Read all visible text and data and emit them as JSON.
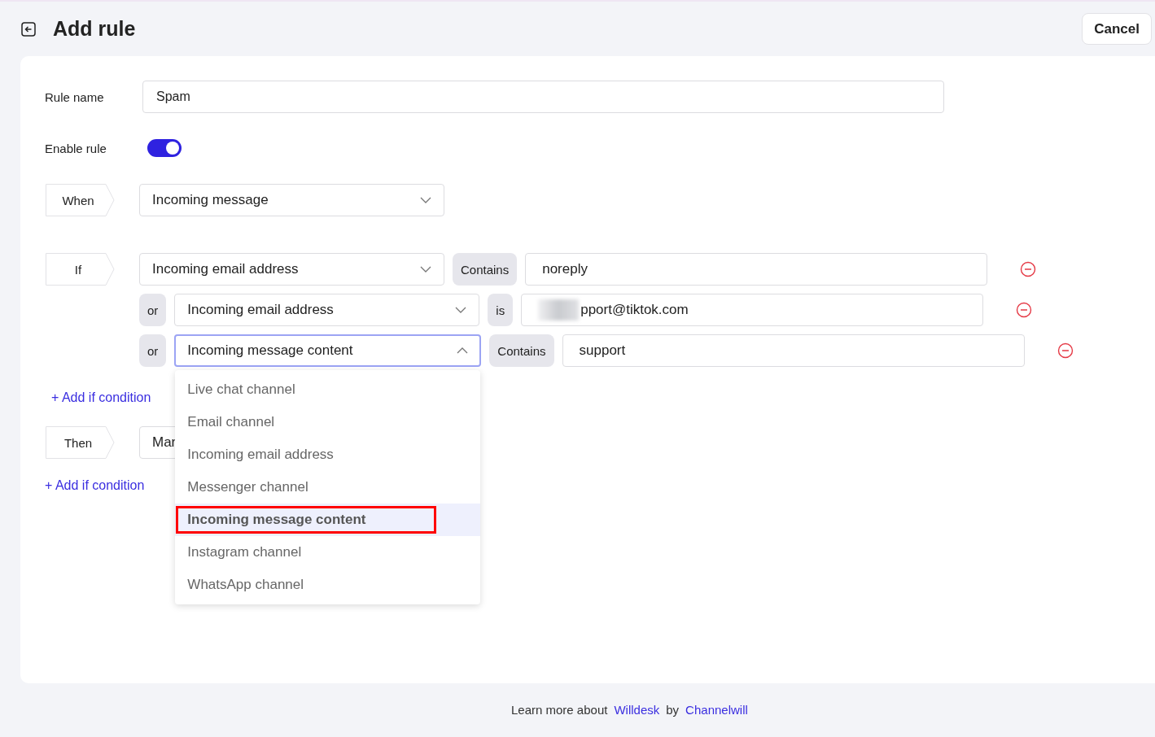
{
  "header": {
    "title": "Add rule",
    "cancel": "Cancel"
  },
  "rule_name": {
    "label": "Rule name",
    "value": "Spam"
  },
  "enable_rule": {
    "label": "Enable rule",
    "on": true
  },
  "when": {
    "tag": "When",
    "value": "Incoming message"
  },
  "if": {
    "tag": "If",
    "conditions": [
      {
        "field": "Incoming email address",
        "expanded": false,
        "operator": "Contains",
        "value": "noreply",
        "redacted": false
      },
      {
        "connector": "or",
        "field": "Incoming email address",
        "expanded": false,
        "operator": "is",
        "value": "pport@tiktok.com",
        "redacted": true
      },
      {
        "connector": "or",
        "field": "Incoming message content",
        "expanded": true,
        "operator": "Contains",
        "value": "support",
        "redacted": false,
        "options": [
          {
            "label": "Live chat channel",
            "selected": false,
            "highlighted": false
          },
          {
            "label": "Email channel",
            "selected": false,
            "highlighted": false
          },
          {
            "label": "Incoming email address",
            "selected": false,
            "highlighted": false
          },
          {
            "label": "Messenger channel",
            "selected": false,
            "highlighted": false
          },
          {
            "label": "Incoming message content",
            "selected": true,
            "highlighted": true
          },
          {
            "label": "Instagram channel",
            "selected": false,
            "highlighted": false
          },
          {
            "label": "WhatsApp channel",
            "selected": false,
            "highlighted": false
          }
        ]
      }
    ],
    "add": "+ Add if condition"
  },
  "then": {
    "tag": "Then",
    "value": "Mar",
    "add": "+ Add if condition"
  },
  "footer": {
    "text": "Learn more about",
    "link1": "Willdesk",
    "by": "by",
    "link2": "Channelwill"
  }
}
